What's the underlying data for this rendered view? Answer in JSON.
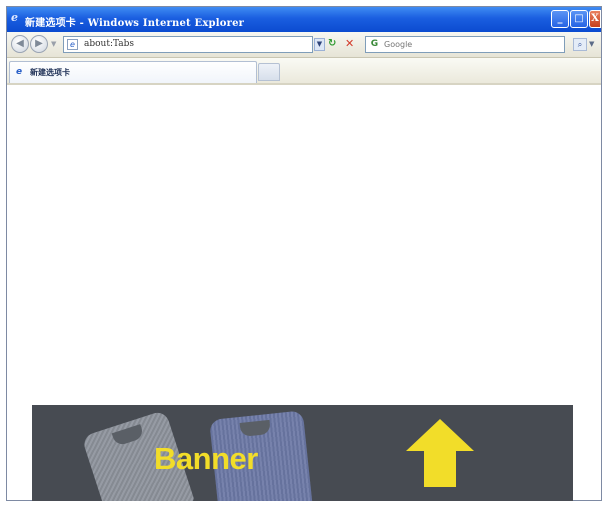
{
  "window": {
    "title": "新建选项卡 - Windows Internet Explorer",
    "controls": {
      "minimize": "_",
      "maximize": "□",
      "close": "X"
    }
  },
  "navbar": {
    "address": "about:Tabs",
    "search_placeholder": "Google",
    "search_provider_letter": "G"
  },
  "tabs": [
    {
      "label": "新建选项卡",
      "active": true
    }
  ],
  "banner": {
    "text": "Banner",
    "text_color": "#f2dd29",
    "background_color": "#474b52"
  }
}
